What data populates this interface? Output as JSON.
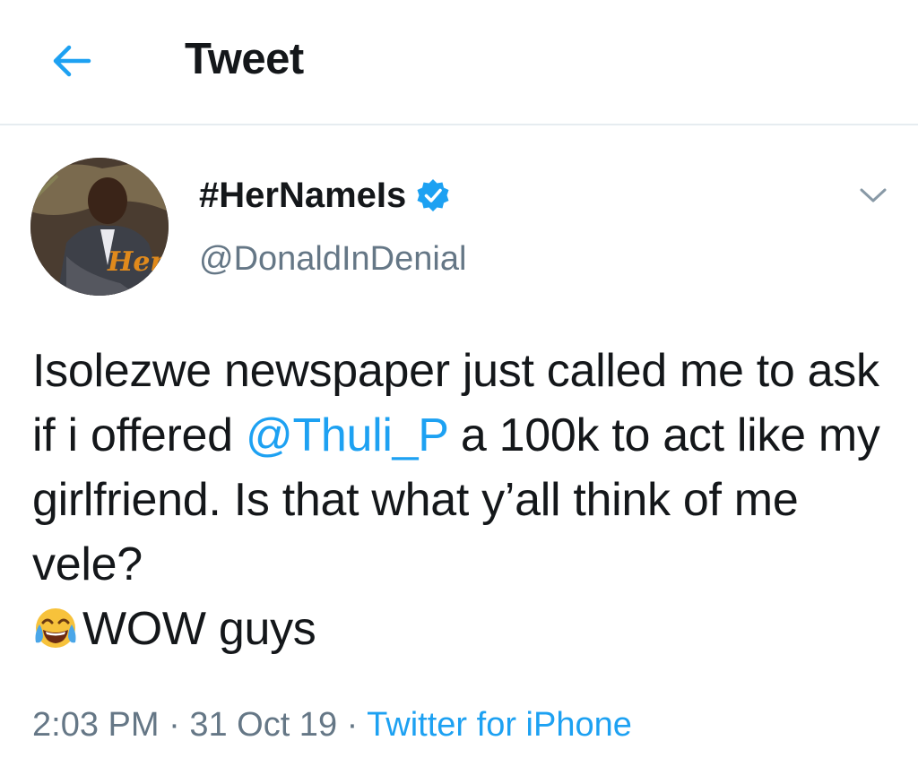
{
  "header": {
    "title": "Tweet",
    "back_icon": "arrow-left-icon"
  },
  "tweet": {
    "author": {
      "display_name": "#HerNameIs",
      "handle": "@DonaldInDenial",
      "verified": true,
      "avatar_text": "Her"
    },
    "text_parts": {
      "part1": "Isolezwe newspaper just called me to ask if i offered ",
      "mention": "@Thuli_P",
      "part2": " a 100k to act like my girlfriend. Is that what y’all think of me vele?",
      "part3": "WOW guys"
    },
    "emoji": "face-with-tears-of-joy-icon",
    "time": "2:03 PM",
    "sep1": " · ",
    "date": "31 Oct 19",
    "sep2": " · ",
    "source": "Twitter for iPhone"
  },
  "colors": {
    "accent": "#1da1f2",
    "text": "#14171a",
    "secondary": "#657786",
    "divider": "#e6ecf0"
  }
}
